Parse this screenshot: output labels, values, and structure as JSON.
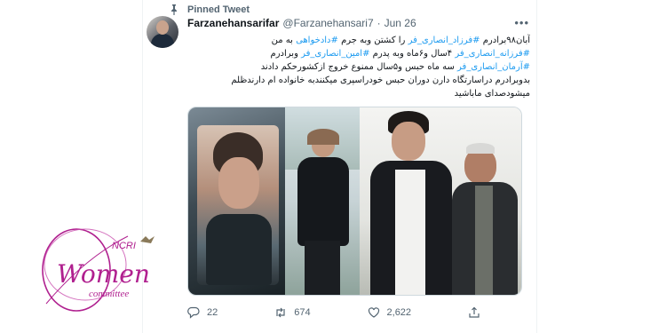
{
  "pinned": {
    "label": "Pinned Tweet",
    "icon": "pin-icon"
  },
  "author": {
    "name": "Farzanehansarifar",
    "handle": "@Farzanehansari7",
    "date": "Jun 26"
  },
  "tweet_text": {
    "l1": {
      "a": "آبان۹۸برادرم ",
      "tag1": "#فرزاد_انصاری_فر",
      "b": " را کشتن وبه جرم ",
      "tag2": "#دادخواهی",
      "c": " به من"
    },
    "l2": {
      "tag1": "#فرزانه_انصاری_فر",
      "a": " ۴سال و۶ماه وبه پدرم ",
      "tag2": "#امین_انصاری_فر",
      "b": " وبرادرم"
    },
    "l3": {
      "tag1": "#آرمان_انصاری_فر",
      "a": " سه ماه حبس و۵سال ممنوع خروج ازکشورحکم دادند"
    },
    "l4": "بدوبرادرم دراسارتگاه دارن دوران حبس خودراسپری میکنندبه خانواده ام دارندظلم",
    "l5": "میشودصدای ماباشید"
  },
  "actions": {
    "replies": "22",
    "retweets": "674",
    "likes": "2,622"
  },
  "watermark": {
    "brand": "NCRI",
    "word": "Women",
    "sub": "committee"
  },
  "colors": {
    "link": "#1d9bf0",
    "muted": "#536471",
    "logo": "#b0208f"
  }
}
